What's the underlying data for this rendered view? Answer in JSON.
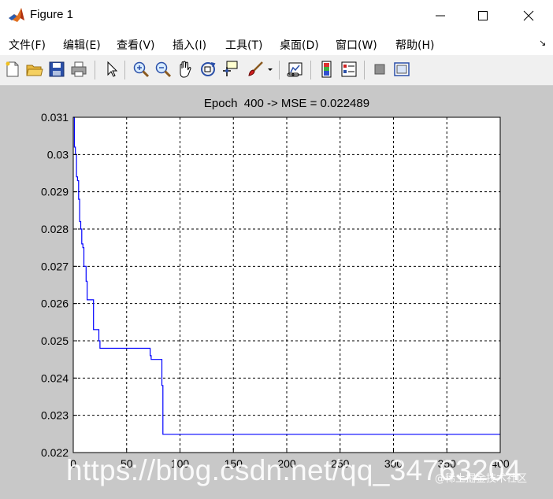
{
  "window": {
    "title": "Figure 1"
  },
  "menu": {
    "items": [
      {
        "label": "文件(F)",
        "name": "menu-file"
      },
      {
        "label": "编辑(E)",
        "name": "menu-edit"
      },
      {
        "label": "查看(V)",
        "name": "menu-view"
      },
      {
        "label": "插入(I)",
        "name": "menu-insert"
      },
      {
        "label": "工具(T)",
        "name": "menu-tools"
      },
      {
        "label": "桌面(D)",
        "name": "menu-desktop"
      },
      {
        "label": "窗口(W)",
        "name": "menu-window"
      },
      {
        "label": "帮助(H)",
        "name": "menu-help"
      }
    ],
    "dock_arrow": "↘"
  },
  "toolbar": {
    "icons": [
      "new-figure-icon",
      "open-file-icon",
      "save-icon",
      "print-icon",
      "select-arrow-icon",
      "zoom-in-icon",
      "zoom-out-icon",
      "pan-hand-icon",
      "rotate-3d-icon",
      "data-cursor-icon",
      "brush-icon",
      "brush-dropdown-icon",
      "link-plot-icon",
      "colorbar-icon",
      "legend-icon",
      "hide-plot-tools-icon",
      "show-plot-tools-icon"
    ]
  },
  "colors": {
    "line": "#0000ff",
    "figure_bg": "#c8c8c8",
    "axes_bg": "#ffffff",
    "grid": "#000000"
  },
  "chart_data": {
    "type": "line",
    "title": "Epoch  400 -> MSE = 0.022489",
    "xlabel": "",
    "ylabel": "",
    "xlim": [
      0,
      400
    ],
    "ylim": [
      0.022,
      0.031
    ],
    "xticks": [
      0,
      50,
      100,
      150,
      200,
      250,
      300,
      350,
      400
    ],
    "yticks": [
      0.022,
      0.023,
      0.024,
      0.025,
      0.026,
      0.027,
      0.028,
      0.029,
      0.03,
      0.031
    ],
    "xtick_labels": [
      "0",
      "50",
      "100",
      "150",
      "200",
      "250",
      "300",
      "350",
      "400"
    ],
    "ytick_labels": [
      "0.022",
      "0.023",
      "0.024",
      "0.025",
      "0.026",
      "0.027",
      "0.028",
      "0.029",
      "0.03",
      "0.031"
    ],
    "grid": true,
    "grid_style": "dashed",
    "series": [
      {
        "color": "#0000ff",
        "x": [
          0,
          1,
          1,
          2,
          2,
          3,
          3,
          4,
          4,
          5,
          5,
          6,
          6,
          7,
          7,
          8,
          8,
          9,
          9,
          10,
          10,
          12,
          12,
          13,
          13,
          15,
          15,
          19,
          19,
          24,
          24,
          25,
          25,
          72,
          72,
          73,
          73,
          83,
          83,
          84,
          84,
          400
        ],
        "y": [
          0.031,
          0.031,
          0.0302,
          0.0302,
          0.03,
          0.03,
          0.0294,
          0.0294,
          0.0293,
          0.0293,
          0.0288,
          0.0288,
          0.0282,
          0.0282,
          0.028,
          0.028,
          0.0276,
          0.0276,
          0.0275,
          0.0275,
          0.027,
          0.027,
          0.0266,
          0.0266,
          0.0261,
          0.0261,
          0.0261,
          0.0261,
          0.0253,
          0.0253,
          0.025,
          0.025,
          0.0248,
          0.0248,
          0.0246,
          0.0246,
          0.0245,
          0.0245,
          0.0238,
          0.0238,
          0.02249,
          0.02249
        ]
      }
    ]
  },
  "watermark": {
    "url_text": "https://blog.csdn.net/qq_34763204",
    "community_text": "@稀土掘金技术社区"
  }
}
